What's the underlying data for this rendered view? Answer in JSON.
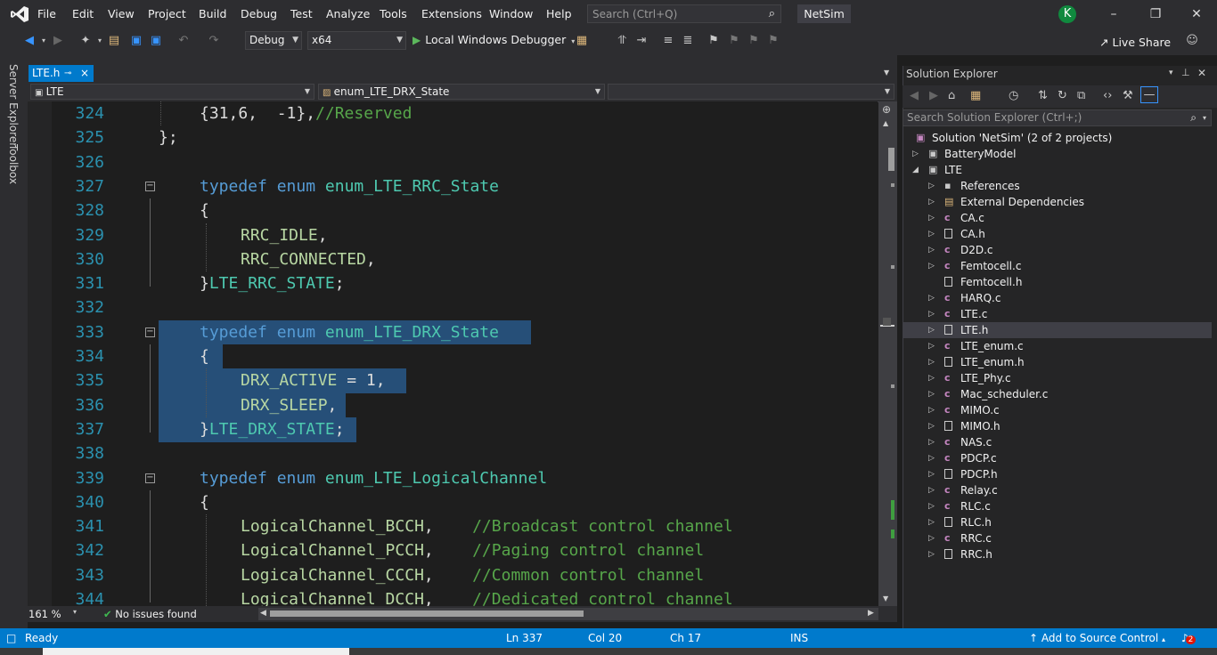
{
  "menu": {
    "items": [
      "File",
      "Edit",
      "View",
      "Project",
      "Build",
      "Debug",
      "Test",
      "Analyze",
      "Tools",
      "Extensions",
      "Window",
      "Help"
    ],
    "search_placeholder": "Search (Ctrl+Q)",
    "solution_name": "NetSim",
    "avatar_letter": "K"
  },
  "toolbar": {
    "config": "Debug",
    "platform": "x64",
    "debugger": "Local Windows Debugger",
    "live_share": "Live Share"
  },
  "side_panels": [
    "Server Explorer",
    "Toolbox"
  ],
  "tab": {
    "label": "LTE.h",
    "pin": "⊸",
    "close": "×"
  },
  "nav": {
    "project": "LTE",
    "member": "enum_LTE_DRX_State"
  },
  "editor": {
    "zoom": "161 %",
    "issues": "No issues found",
    "lines": [
      {
        "num": "324",
        "indent": 2,
        "tokens": [
          {
            "t": "{31,6,  -1},",
            "c": "pl"
          },
          {
            "t": "//Reserved",
            "c": "cm"
          }
        ]
      },
      {
        "num": "325",
        "indent": 1,
        "tokens": [
          {
            "t": "};",
            "c": "pl"
          }
        ]
      },
      {
        "num": "326",
        "indent": 0,
        "tokens": []
      },
      {
        "num": "327",
        "indent": 2,
        "tokens": [
          {
            "t": "typedef",
            "c": "kw"
          },
          {
            "t": " ",
            "c": "pl"
          },
          {
            "t": "enum",
            "c": "kw"
          },
          {
            "t": " ",
            "c": "pl"
          },
          {
            "t": "enum_LTE_RRC_State",
            "c": "ty"
          }
        ]
      },
      {
        "num": "328",
        "indent": 2,
        "tokens": [
          {
            "t": "{",
            "c": "pl"
          }
        ]
      },
      {
        "num": "329",
        "indent": 3,
        "tokens": [
          {
            "t": "RRC_IDLE",
            "c": "en"
          },
          {
            "t": ",",
            "c": "pl"
          }
        ]
      },
      {
        "num": "330",
        "indent": 3,
        "tokens": [
          {
            "t": "RRC_CONNECTED",
            "c": "en"
          },
          {
            "t": ",",
            "c": "pl"
          }
        ]
      },
      {
        "num": "331",
        "indent": 2,
        "tokens": [
          {
            "t": "}",
            "c": "pl"
          },
          {
            "t": "LTE_RRC_STATE",
            "c": "ty"
          },
          {
            "t": ";",
            "c": "pl"
          }
        ]
      },
      {
        "num": "332",
        "indent": 0,
        "tokens": []
      },
      {
        "num": "333",
        "indent": 2,
        "tokens": [
          {
            "t": "typedef",
            "c": "kw"
          },
          {
            "t": " ",
            "c": "pl"
          },
          {
            "t": "enum",
            "c": "kw"
          },
          {
            "t": " ",
            "c": "pl"
          },
          {
            "t": "enum_LTE_DRX_State",
            "c": "ty"
          }
        ]
      },
      {
        "num": "334",
        "indent": 2,
        "tokens": [
          {
            "t": "{",
            "c": "pl"
          }
        ]
      },
      {
        "num": "335",
        "indent": 3,
        "tokens": [
          {
            "t": "DRX_ACTIVE",
            "c": "en"
          },
          {
            "t": " = 1,",
            "c": "pl"
          }
        ]
      },
      {
        "num": "336",
        "indent": 3,
        "tokens": [
          {
            "t": "DRX_SLEEP",
            "c": "en"
          },
          {
            "t": ",",
            "c": "pl"
          }
        ]
      },
      {
        "num": "337",
        "indent": 2,
        "tokens": [
          {
            "t": "}",
            "c": "pl"
          },
          {
            "t": "LTE_DRX_STATE",
            "c": "ty"
          },
          {
            "t": ";",
            "c": "pl"
          }
        ]
      },
      {
        "num": "338",
        "indent": 0,
        "tokens": []
      },
      {
        "num": "339",
        "indent": 2,
        "tokens": [
          {
            "t": "typedef",
            "c": "kw"
          },
          {
            "t": " ",
            "c": "pl"
          },
          {
            "t": "enum",
            "c": "kw"
          },
          {
            "t": " ",
            "c": "pl"
          },
          {
            "t": "enum_LTE_LogicalChannel",
            "c": "ty"
          }
        ]
      },
      {
        "num": "340",
        "indent": 2,
        "tokens": [
          {
            "t": "{",
            "c": "pl"
          }
        ]
      },
      {
        "num": "341",
        "indent": 3,
        "tokens": [
          {
            "t": "LogicalChannel_BCCH",
            "c": "en"
          },
          {
            "t": ",    ",
            "c": "pl"
          },
          {
            "t": "//Broadcast control channel",
            "c": "cm"
          }
        ]
      },
      {
        "num": "342",
        "indent": 3,
        "tokens": [
          {
            "t": "LogicalChannel_PCCH",
            "c": "en"
          },
          {
            "t": ",    ",
            "c": "pl"
          },
          {
            "t": "//Paging control channel",
            "c": "cm"
          }
        ]
      },
      {
        "num": "343",
        "indent": 3,
        "tokens": [
          {
            "t": "LogicalChannel_CCCH",
            "c": "en"
          },
          {
            "t": ",    ",
            "c": "pl"
          },
          {
            "t": "//Common control channel",
            "c": "cm"
          }
        ]
      },
      {
        "num": "344",
        "indent": 3,
        "tokens": [
          {
            "t": "LogicalChannel_DCCH",
            "c": "en"
          },
          {
            "t": ",    ",
            "c": "pl"
          },
          {
            "t": "//Dedicated control channel",
            "c": "cm"
          }
        ]
      }
    ]
  },
  "solution_explorer": {
    "title": "Solution Explorer",
    "search_placeholder": "Search Solution Explorer (Ctrl+;)",
    "items": [
      {
        "label": "Solution 'NetSim' (2 of 2 projects)",
        "level": 0,
        "kind": "solution",
        "twisty": ""
      },
      {
        "label": "BatteryModel",
        "level": 1,
        "kind": "project",
        "twisty": "collapsed"
      },
      {
        "label": "LTE",
        "level": 1,
        "kind": "project",
        "twisty": "expanded"
      },
      {
        "label": "References",
        "level": 2,
        "kind": "refs",
        "twisty": "collapsed"
      },
      {
        "label": "External Dependencies",
        "level": 2,
        "kind": "deps",
        "twisty": "collapsed"
      },
      {
        "label": "CA.c",
        "level": 2,
        "kind": "c",
        "twisty": "collapsed"
      },
      {
        "label": "CA.h",
        "level": 2,
        "kind": "h",
        "twisty": "collapsed"
      },
      {
        "label": "D2D.c",
        "level": 2,
        "kind": "c",
        "twisty": "collapsed"
      },
      {
        "label": "Femtocell.c",
        "level": 2,
        "kind": "c",
        "twisty": "collapsed"
      },
      {
        "label": "Femtocell.h",
        "level": 2,
        "kind": "h",
        "twisty": ""
      },
      {
        "label": "HARQ.c",
        "level": 2,
        "kind": "c",
        "twisty": "collapsed"
      },
      {
        "label": "LTE.c",
        "level": 2,
        "kind": "c",
        "twisty": "collapsed"
      },
      {
        "label": "LTE.h",
        "level": 2,
        "kind": "h",
        "twisty": "collapsed",
        "selected": true
      },
      {
        "label": "LTE_enum.c",
        "level": 2,
        "kind": "c",
        "twisty": "collapsed"
      },
      {
        "label": "LTE_enum.h",
        "level": 2,
        "kind": "h",
        "twisty": "collapsed"
      },
      {
        "label": "LTE_Phy.c",
        "level": 2,
        "kind": "c",
        "twisty": "collapsed"
      },
      {
        "label": "Mac_scheduler.c",
        "level": 2,
        "kind": "c",
        "twisty": "collapsed"
      },
      {
        "label": "MIMO.c",
        "level": 2,
        "kind": "c",
        "twisty": "collapsed"
      },
      {
        "label": "MIMO.h",
        "level": 2,
        "kind": "h",
        "twisty": "collapsed"
      },
      {
        "label": "NAS.c",
        "level": 2,
        "kind": "c",
        "twisty": "collapsed"
      },
      {
        "label": "PDCP.c",
        "level": 2,
        "kind": "c",
        "twisty": "collapsed"
      },
      {
        "label": "PDCP.h",
        "level": 2,
        "kind": "h",
        "twisty": "collapsed"
      },
      {
        "label": "Relay.c",
        "level": 2,
        "kind": "c",
        "twisty": "collapsed"
      },
      {
        "label": "RLC.c",
        "level": 2,
        "kind": "c",
        "twisty": "collapsed"
      },
      {
        "label": "RLC.h",
        "level": 2,
        "kind": "h",
        "twisty": "collapsed"
      },
      {
        "label": "RRC.c",
        "level": 2,
        "kind": "c",
        "twisty": "collapsed"
      },
      {
        "label": "RRC.h",
        "level": 2,
        "kind": "h",
        "twisty": "collapsed"
      }
    ]
  },
  "status": {
    "ready": "Ready",
    "line": "Ln 337",
    "col": "Col 20",
    "ch": "Ch 17",
    "mode": "INS",
    "source_control": "Add to Source Control",
    "notifications": "2"
  },
  "colors": {
    "accent": "#007acc",
    "keyword": "#569cd6",
    "type": "#4ec9b0",
    "enum_member": "#b8d7a3",
    "comment": "#57a64a",
    "line_number": "#2b91af",
    "selection": "#264f78"
  }
}
